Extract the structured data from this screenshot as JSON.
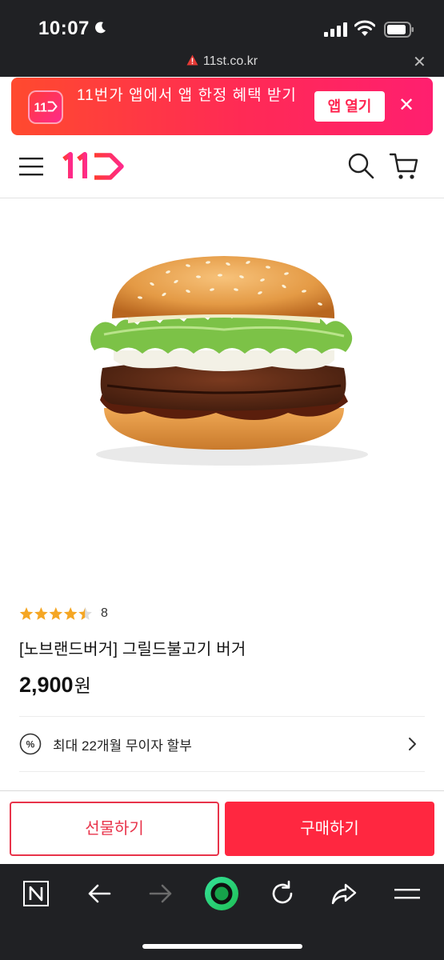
{
  "status_bar": {
    "time": "10:07"
  },
  "browser": {
    "url": "11st.co.kr"
  },
  "app_banner": {
    "text": "11번가 앱에서 앱 한정 혜택 받기",
    "open_button": "앱 열기",
    "close": "✕",
    "logo_text": "11"
  },
  "product": {
    "rating_count": "8",
    "rating_value": 4.5,
    "title": "[노브랜드버거] 그릴드불고기 버거",
    "price": "2,900",
    "price_unit": "원"
  },
  "installment": {
    "text": "최대 22개월 무이자 할부"
  },
  "actions": {
    "gift": "선물하기",
    "buy": "구매하기"
  },
  "colors": {
    "brand": "#ff2740",
    "banner_start": "#ff4a2e",
    "banner_end": "#ff1f6f",
    "star": "#f5a623",
    "dark_chrome": "#202124"
  },
  "icons": [
    "moon-icon",
    "signal-icon",
    "wifi-icon",
    "battery-icon",
    "warning-icon",
    "close-icon",
    "menu-icon",
    "search-icon",
    "cart-icon",
    "percent-icon",
    "chevron-right-icon",
    "naver-n-icon",
    "back-arrow-icon",
    "forward-arrow-icon",
    "green-dot-icon",
    "refresh-icon",
    "share-icon",
    "hamburger-icon"
  ]
}
